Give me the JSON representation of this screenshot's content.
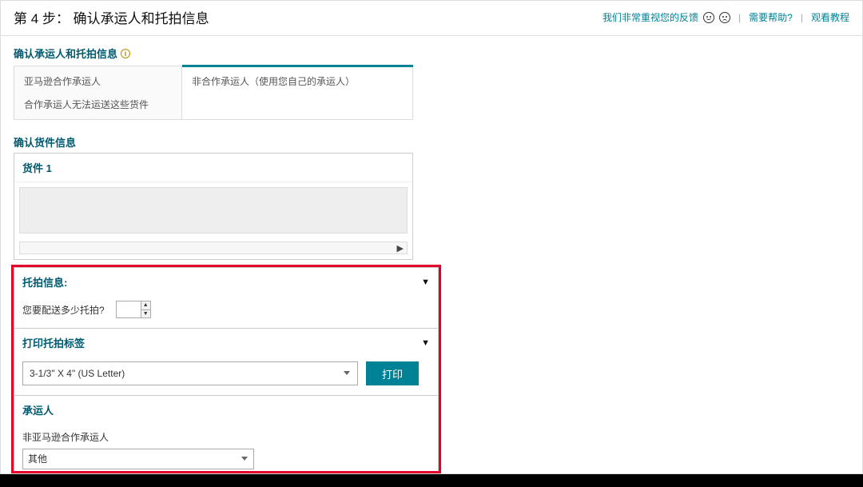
{
  "header": {
    "step_title": "第 4 步：  确认承运人和托拍信息",
    "feedback_text": "我们非常重视您的反馈",
    "help_link": "需要帮助?",
    "tutorial_link": "观看教程"
  },
  "carrier_section": {
    "title": "确认承运人和托拍信息",
    "tab_left_title": "亚马逊合作承运人",
    "tab_left_note": "合作承运人无法运送这些货件",
    "tab_right_title": "非合作承运人（使用您自己的承运人）"
  },
  "shipment": {
    "section_title": "确认货件信息",
    "name": "货件 1"
  },
  "pallet": {
    "title": "托拍信息:",
    "qty_label": "您要配送多少托拍?",
    "qty_value": ""
  },
  "print": {
    "title": "打印托拍标签",
    "size_option": "3-1/3\" X 4\" (US Letter)",
    "button": "打印"
  },
  "carrier": {
    "title": "承运人",
    "label": "非亚马逊合作承运人",
    "selected": "其他"
  }
}
